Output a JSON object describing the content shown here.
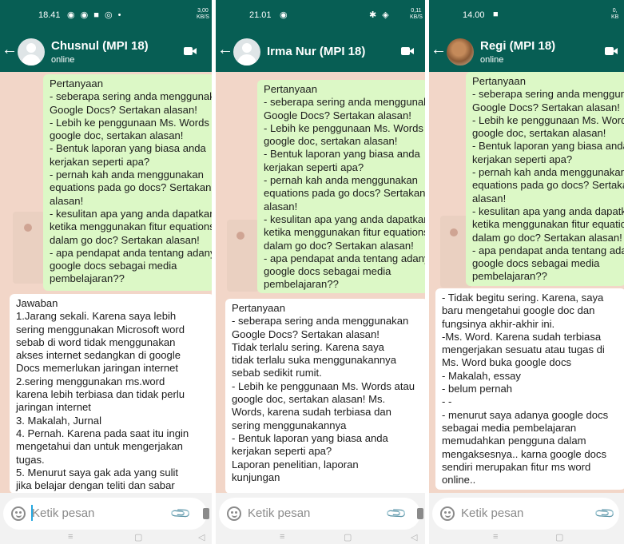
{
  "panels": [
    {
      "status_time": "18.41",
      "status_icons": "◉ ◉ ■ ◎ •",
      "net_speed_value": "3,00",
      "net_speed_unit": "KB/S",
      "contact_name": "Chusnul (MPI 18)",
      "contact_status": "online",
      "outgoing_lines": [
        "Pertanyaan",
        "- seberapa sering anda menggunakan",
        "Google Docs? Sertakan alasan!",
        "- Lebih ke penggunaan Ms. Words atau",
        "google doc, sertakan alasan!",
        "- Bentuk laporan yang biasa anda",
        "kerjakan seperti apa?",
        "- pernah kah anda menggunakan",
        "equations pada go docs? Sertakan",
        "alasan!",
        "- kesulitan apa yang anda dapatkan",
        "ketika menggunakan fitur equations",
        "dalam go doc? Sertakan alasan!",
        "- apa pendapat anda tentang adanya",
        "google docs sebagai media",
        "pembelajaran??"
      ],
      "incoming_lines": [
        "Jawaban",
        "1.Jarang sekali. Karena saya lebih",
        "sering menggunakan Microsoft word",
        "sebab di word tidak menggunakan",
        "akses internet sedangkan di google",
        "Docs memerlukan jaringan internet",
        "2.sering menggunakan ms.word",
        "karena lebih terbiasa dan tidak perlu",
        "jaringan internet",
        "3. Makalah, Jurnal",
        "4. Pernah. Karena pada saat itu ingin",
        "mengetahui dan untuk mengerjakan",
        "tugas.",
        "5. Menurut saya gak ada yang sulit",
        "jika belajar dengan teliti dan sabar"
      ],
      "input_placeholder": "Ketik pesan"
    },
    {
      "status_time": "21.01",
      "status_icons": "◉",
      "right_status_icons": "✱ ◈",
      "net_speed_value": "0,11",
      "net_speed_unit": "KB/S",
      "contact_name": "Irma Nur (MPI 18)",
      "contact_status": "",
      "outgoing_lines": [
        "Pertanyaan",
        "- seberapa sering anda menggunakan",
        "Google Docs? Sertakan alasan!",
        "- Lebih ke penggunaan Ms. Words atau",
        "google doc, sertakan alasan!",
        "- Bentuk laporan yang biasa anda",
        "kerjakan seperti apa?",
        "- pernah kah anda menggunakan",
        "equations pada go docs? Sertakan",
        "alasan!",
        "- kesulitan apa yang anda dapatkan",
        "ketika menggunakan fitur equations",
        "dalam go doc? Sertakan alasan!",
        "- apa pendapat anda tentang adanya",
        "google docs sebagai media",
        "pembelajaran??"
      ],
      "incoming_lines": [
        "Pertanyaan",
        "- seberapa sering anda menggunakan",
        "Google Docs? Sertakan alasan!",
        "Tidak terlalu sering. Karena saya",
        "tidak terlalu suka menggunakannya",
        "sebab sedikit rumit.",
        "- Lebih ke penggunaan Ms. Words atau",
        "google doc, sertakan alasan! Ms.",
        "Words, karena sudah terbiasa dan",
        "sering menggunakannya",
        "- Bentuk laporan yang biasa anda",
        "kerjakan seperti apa?",
        "Laporan penelitian, laporan",
        "kunjungan"
      ],
      "input_placeholder": "Ketik pesan"
    },
    {
      "status_time": "14.00",
      "status_icons": "■",
      "net_speed_value": "0,",
      "net_speed_unit": "KB",
      "contact_name": "Regi (MPI 18)",
      "contact_status": "online",
      "outgoing_lines": [
        "Pertanyaan",
        "- seberapa sering anda menggunakan",
        "Google Docs? Sertakan alasan!",
        "- Lebih ke penggunaan Ms. Words atau",
        "google doc, sertakan alasan!",
        "- Bentuk laporan yang biasa anda",
        "kerjakan seperti apa?",
        "- pernah kah anda menggunakan",
        "equations pada go docs? Sertakan",
        "alasan!",
        "- kesulitan apa yang anda dapatkan",
        "ketika menggunakan fitur equations",
        "dalam go doc? Sertakan alasan!",
        "- apa pendapat anda tentang adanya",
        "google docs sebagai media",
        "pembelajaran??"
      ],
      "incoming_lines": [
        "- Tidak begitu sering. Karena, saya",
        "baru mengetahui google doc dan",
        "fungsinya akhir-akhir ini.",
        "-Ms. Word. Karena sudah terbiasa",
        "mengerjakan sesuatu atau tugas di",
        "Ms. Word buka google docs",
        "- Makalah, essay",
        "- belum pernah",
        "- -",
        "- menurut saya adanya google docs",
        "sebagai media pembelajaran",
        "memudahkan pengguna dalam",
        "mengaksesnya.. karna google docs",
        "sendiri merupakan fitur ms word",
        "online.."
      ],
      "input_placeholder": "Ketik pesan"
    }
  ],
  "nav_symbols": {
    "recents": "≡",
    "home": "▢",
    "back": "◁"
  },
  "colors": {
    "header": "#075e54",
    "outgoing_bubble": "#dcf8c6",
    "incoming_bubble": "#ffffff",
    "wallpaper": "#f2d6c8"
  }
}
